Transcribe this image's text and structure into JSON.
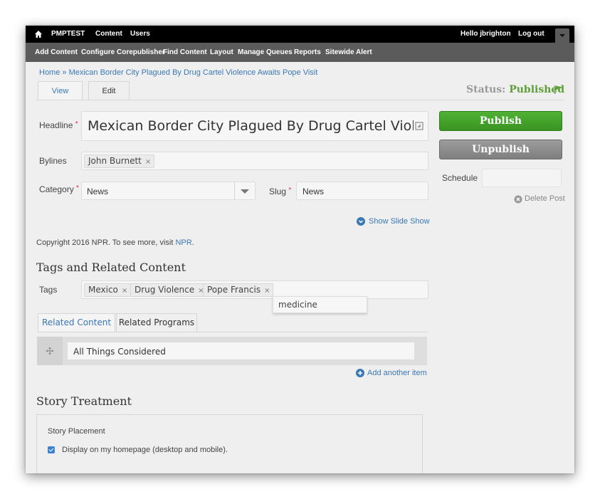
{
  "topbar": {
    "site_name": "PMPTEST",
    "items": [
      "Content",
      "Users"
    ],
    "greeting": "Hello jbrighton",
    "logout": "Log out"
  },
  "subnav": {
    "items": [
      "Add Content",
      "Configure Corepublisher",
      "Find Content",
      "Layout",
      "Manage Queues",
      "Reports",
      "Sitewide Alert"
    ]
  },
  "breadcrumb": "Home » Mexican Border City Plagued By Drug Cartel Violence Awaits Pope Visit",
  "tabs": {
    "view": "View",
    "edit": "Edit"
  },
  "status": {
    "label": "Status:",
    "value": "Published"
  },
  "form": {
    "headline_label": "Headline",
    "headline_value": "Mexican Border City Plagued By Drug Cartel Violence Awaits Pope Visit",
    "bylines_label": "Bylines",
    "bylines": [
      "John Burnett"
    ],
    "category_label": "Category",
    "category_value": "News",
    "slug_label": "Slug",
    "slug_value": "News",
    "required_mark": "*",
    "chip_remove": "×"
  },
  "sidebar": {
    "publish": "Publish",
    "unpublish": "Unpublish",
    "schedule_label": "Schedule",
    "delete_post": "Delete Post"
  },
  "slideshow_link": "Show Slide Show",
  "copyright": {
    "text": "Copyright 2016 NPR. To see more, visit",
    "link": "NPR",
    "end": "."
  },
  "tags_section": {
    "title": "Tags and Related Content",
    "tags_label": "Tags",
    "tags": [
      "Mexico",
      "Drug Violence",
      "Pope Francis"
    ],
    "suggestion": "medicine"
  },
  "related_tabs": {
    "related_content": "Related Content",
    "related_programs": "Related Programs"
  },
  "program_value": "All Things Considered",
  "add_item": "Add another item",
  "story_treatment": {
    "title": "Story Treatment",
    "placement_label": "Story Placement",
    "homepage_checkbox": "Display on my homepage (desktop and mobile).",
    "homepage_checked": true
  },
  "colors": {
    "accent_blue": "#3b78b4",
    "publish_green": "#4fb134",
    "status_green": "#5f9e3a"
  }
}
